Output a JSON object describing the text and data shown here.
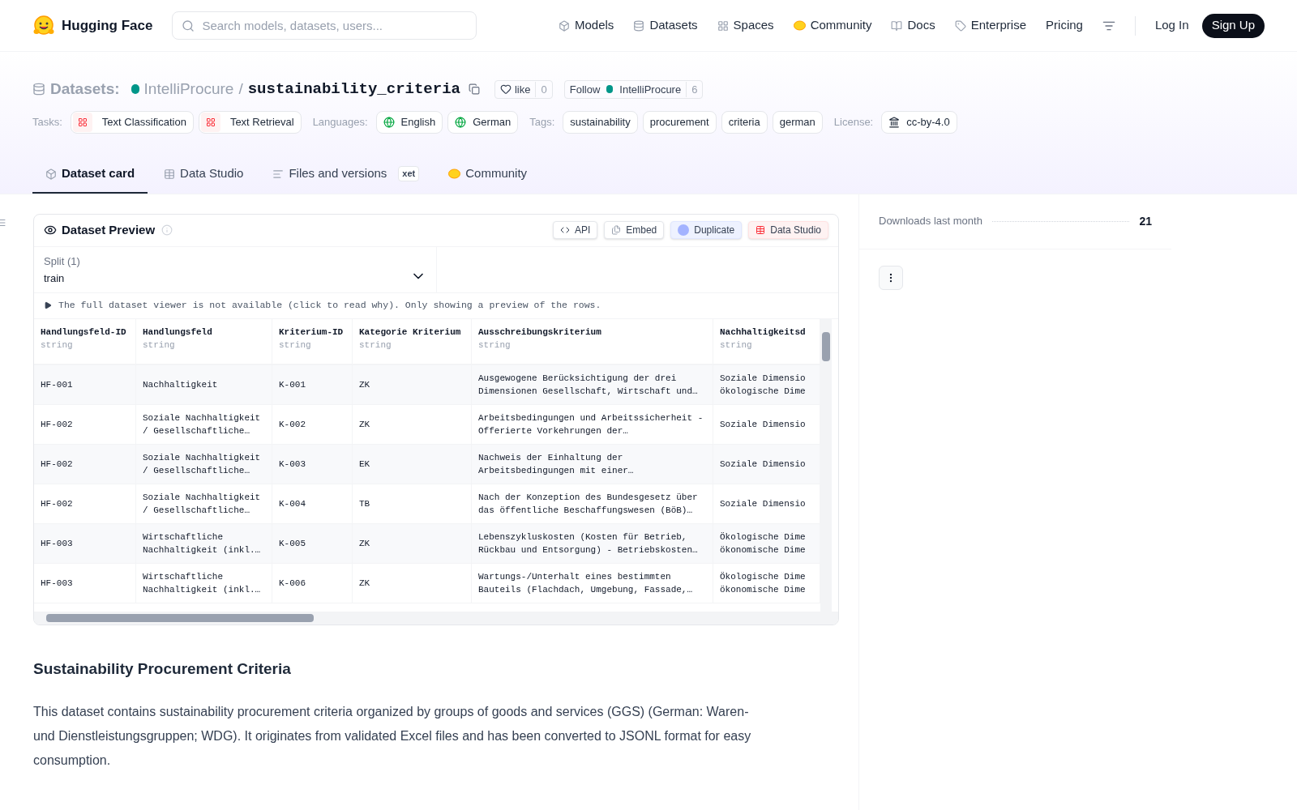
{
  "nav": {
    "logo": "Hugging Face",
    "search": {
      "placeholder": "Search models, datasets, users..."
    },
    "links": [
      {
        "label": "Models"
      },
      {
        "label": "Datasets"
      },
      {
        "label": "Spaces"
      },
      {
        "label": "Community"
      },
      {
        "label": "Docs"
      },
      {
        "label": "Enterprise"
      },
      {
        "label": "Pricing"
      }
    ],
    "login": "Log In",
    "signup": "Sign Up"
  },
  "repo": {
    "type": "Datasets:",
    "owner": "IntelliProcure",
    "separator": "/",
    "name": "sustainability_criteria",
    "like": "like",
    "likes": "0",
    "follow": "Follow",
    "follow_owner": "IntelliProcure",
    "followers": "6"
  },
  "tag_groups": [
    {
      "label": "Tasks:",
      "tags": [
        {
          "label": "Text Classification",
          "kind": "task"
        },
        {
          "label": "Text Retrieval",
          "kind": "task"
        }
      ]
    },
    {
      "label": "Languages:",
      "tags": [
        {
          "label": "English",
          "kind": "language"
        },
        {
          "label": "German",
          "kind": "language"
        }
      ]
    },
    {
      "label": "Tags:",
      "tags": [
        {
          "label": "sustainability",
          "kind": "plain"
        },
        {
          "label": "procurement",
          "kind": "plain"
        },
        {
          "label": "criteria",
          "kind": "plain"
        },
        {
          "label": "german",
          "kind": "plain"
        }
      ]
    },
    {
      "label": "License:",
      "tags": [
        {
          "label": "cc-by-4.0",
          "kind": "license"
        }
      ]
    }
  ],
  "tabs": [
    {
      "label": "Dataset card",
      "selected": true
    },
    {
      "label": "Data Studio",
      "selected": false
    },
    {
      "label": "Files and versions",
      "selected": false,
      "badge": "xet"
    },
    {
      "label": "Community",
      "selected": false
    }
  ],
  "preview": {
    "title": "Dataset Preview",
    "buttons": [
      {
        "label": "API",
        "kind": "api"
      },
      {
        "label": "Embed",
        "kind": "embed"
      },
      {
        "label": "Duplicate",
        "kind": "duplicate"
      },
      {
        "label": "Data Studio",
        "kind": "studio"
      }
    ],
    "split_label": "Split (1)",
    "split_value": "train",
    "notice": "The full dataset viewer is not available (click to read why). Only showing a preview of the rows.",
    "columns": [
      {
        "name": "Handlungsfeld-ID",
        "type": "string"
      },
      {
        "name": "Handlungsfeld",
        "type": "string"
      },
      {
        "name": "Kriterium-ID",
        "type": "string"
      },
      {
        "name": "Kategorie Kriterium",
        "type": "string"
      },
      {
        "name": "Ausschreibungskriterium",
        "type": "string"
      },
      {
        "name": "Nachhaltigkeitsd",
        "type": "string"
      }
    ],
    "rows": [
      [
        "HF-001",
        "Nachhaltigkeit",
        "K-001",
        "ZK",
        "Ausgewogene Berücksichtigung der drei Dimensionen Gesellschaft, Wirtschaft und…",
        "Soziale Dimensio\nökologische Dime"
      ],
      [
        "HF-002",
        "Soziale Nachhaltigkeit / Gesellschaftliche…",
        "K-002",
        "ZK",
        "Arbeitsbedingungen und Arbeitssicherheit - Offerierte Vorkehrungen der…",
        "Soziale Dimensio"
      ],
      [
        "HF-002",
        "Soziale Nachhaltigkeit / Gesellschaftliche…",
        "K-003",
        "EK",
        "Nachweis der Einhaltung der Arbeitsbedingungen mit einer…",
        "Soziale Dimensio"
      ],
      [
        "HF-002",
        "Soziale Nachhaltigkeit / Gesellschaftliche…",
        "K-004",
        "TB",
        "Nach der Konzeption des Bundesgesetz über das öffentliche Beschaffungswesen (BöB)…",
        "Soziale Dimensio"
      ],
      [
        "HF-003",
        "Wirtschaftliche Nachhaltigkeit (inkl.…",
        "K-005",
        "ZK",
        "Lebenszykluskosten (Kosten für Betrieb, Rückbau und Entsorgung) - Betriebskosten…",
        "Ökologische Dime\nökonomische Dime"
      ],
      [
        "HF-003",
        "Wirtschaftliche Nachhaltigkeit (inkl.…",
        "K-006",
        "ZK",
        "Wartungs-/Unterhalt eines bestimmten Bauteils (Flachdach, Umgebung, Fassade,…",
        "Ökologische Dime\nökonomische Dime"
      ]
    ]
  },
  "card": {
    "heading": "Sustainability Procurement Criteria",
    "paragraph": "This dataset contains sustainability procurement criteria organized by groups of goods and services (GGS) (German: Waren- und Dienstleistungsgruppen; WDG). It originates from validated Excel files and has been converted to JSONL format for easy consumption."
  },
  "sidebar": {
    "downloads_label": "Downloads last month",
    "downloads": "21"
  }
}
